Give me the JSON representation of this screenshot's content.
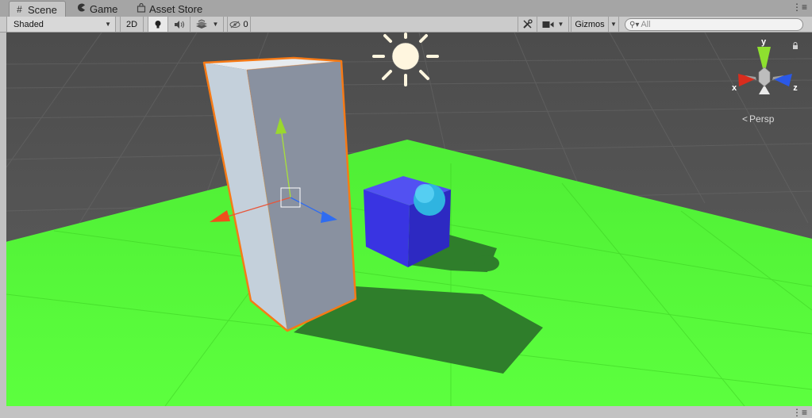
{
  "tabs": [
    {
      "label": "Scene",
      "icon": "grid-icon",
      "active": true
    },
    {
      "label": "Game",
      "icon": "pacman-icon",
      "active": false
    },
    {
      "label": "Asset Store",
      "icon": "shopping-bag-icon",
      "active": false
    }
  ],
  "toolbar": {
    "shading_mode": "Shaded",
    "mode_2d": "2D",
    "lighting_icon": "lightbulb-icon",
    "audio_icon": "speaker-icon",
    "effects_icon": "effects-icon",
    "hidden_icon": "eye-slash-icon",
    "hidden_count": "0",
    "tools_icon": "tools-icon",
    "camera_icon": "camera-icon",
    "gizmos_label": "Gizmos",
    "search_placeholder": "All"
  },
  "scene": {
    "orientation_gizmo": {
      "x_label": "x",
      "y_label": "y",
      "z_label": "z"
    },
    "projection_label": "Persp",
    "colors": {
      "ground": "#55ff38",
      "cube": "#3a35e6",
      "sphere": "#33c8f2",
      "selection": "#f67a16"
    }
  }
}
